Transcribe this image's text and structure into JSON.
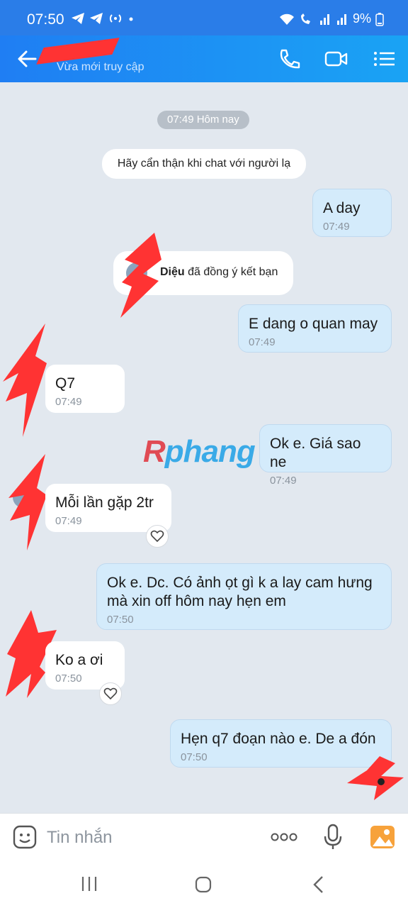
{
  "status_bar": {
    "time": "07:50",
    "battery": "9%",
    "icons": [
      "telegram-icon",
      "telegram-icon",
      "hotspot-icon",
      "dot-icon",
      "wifi-icon",
      "wifi-call-icon",
      "signal-icon",
      "signal-icon",
      "battery-icon"
    ]
  },
  "header": {
    "contact_status": "Vừa mới truy cập",
    "icons": [
      "back-arrow-icon",
      "phone-icon",
      "video-call-icon",
      "menu-list-icon"
    ]
  },
  "chat": {
    "date_chip": "07:49 Hôm nay",
    "notice": "Hãy cẩn thận khi chat với người lạ",
    "friend_event": {
      "name": "Diệu",
      "text": "đã đồng ý kết bạn"
    },
    "messages": [
      {
        "dir": "out",
        "text": "A day",
        "time": "07:49"
      },
      {
        "dir": "out",
        "text": "E dang o quan may",
        "time": "07:49"
      },
      {
        "dir": "in",
        "text": "Q7",
        "time": "07:49"
      },
      {
        "dir": "out",
        "text": "Ok e. Giá sao ne",
        "time": "07:49"
      },
      {
        "dir": "in",
        "text": "Mỗi lần gặp 2tr",
        "time": "07:49"
      },
      {
        "dir": "out",
        "text": "Ok e. Dc. Có ảnh ọt gì k a lay cam hưng mà xin off hôm nay hẹn em",
        "time": "07:50"
      },
      {
        "dir": "in",
        "text": "Ko a ơi",
        "time": "07:50"
      },
      {
        "dir": "out",
        "text": "Hẹn q7 đoạn nào e. De a đón",
        "time": "07:50"
      }
    ],
    "watermark": {
      "part1": "R",
      "part2": "phang"
    }
  },
  "input": {
    "placeholder": "Tin nhắn",
    "icons": [
      "sticker-icon",
      "more-icon",
      "mic-icon",
      "image-icon"
    ]
  },
  "nav": {
    "icons": [
      "recent-apps-icon",
      "home-icon",
      "back-icon"
    ]
  },
  "colors": {
    "header": "#1f7ef3",
    "outgoing_bubble": "#d4ebfb",
    "incoming_bubble": "#ffffff",
    "background": "#e2e8ef",
    "redaction": "#ff3333"
  }
}
